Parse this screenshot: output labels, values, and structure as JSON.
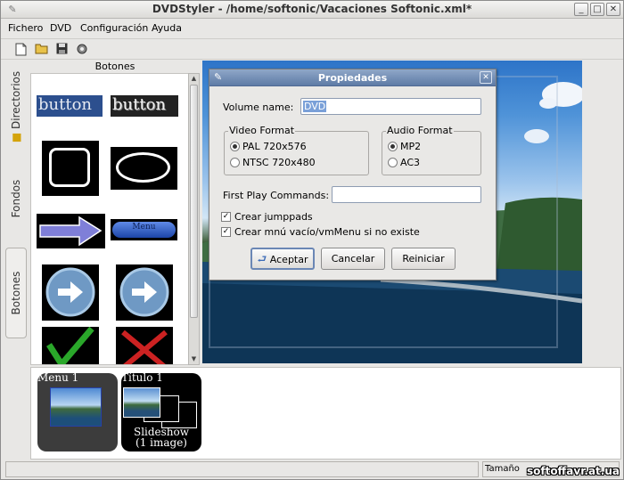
{
  "window": {
    "title": "DVDStyler - /home/softonic/Vacaciones Softonic.xml*",
    "controls": {
      "minimize": "_",
      "maximize": "□",
      "close": "✕"
    }
  },
  "menu": [
    {
      "label": "Fichero",
      "accel": "F"
    },
    {
      "label": "DVD",
      "accel": "D"
    },
    {
      "label": "Configuración",
      "accel": "C"
    },
    {
      "label": "Ayuda",
      "accel": "A"
    }
  ],
  "toolbar": {
    "icons": [
      "new-file-icon",
      "open-folder-icon",
      "save-icon",
      "settings-icon"
    ]
  },
  "side_tabs": {
    "directorios": "Directorios",
    "fondos": "Fondos",
    "botones": "Botones"
  },
  "buttons_panel": {
    "header": "Botones",
    "items": [
      {
        "type": "text-button",
        "text": "button"
      },
      {
        "type": "text-button-shadow",
        "text": "button"
      },
      {
        "type": "square-frame"
      },
      {
        "type": "ellipse-frame"
      },
      {
        "type": "arrow"
      },
      {
        "type": "pill",
        "text": "Menu"
      },
      {
        "type": "round-arrow"
      },
      {
        "type": "round-arrow"
      },
      {
        "type": "check"
      },
      {
        "type": "cross"
      }
    ]
  },
  "titleset": {
    "menu1": "Menu 1",
    "titulo1": "Título 1",
    "slideshow_line1": "Slideshow",
    "slideshow_line2": "(1 image)"
  },
  "status": {
    "left": "",
    "right": "Tamaño"
  },
  "watermark": "softoffavr.at.ua",
  "dialog": {
    "title": "Propiedades",
    "volume_label": "Volume name:",
    "volume_value": "DVD",
    "video_group": "Video Format",
    "video_options": [
      {
        "label": "PAL 720x576",
        "selected": true
      },
      {
        "label": "NTSC 720x480",
        "selected": false
      }
    ],
    "audio_group": "Audio Format",
    "audio_options": [
      {
        "label": "MP2",
        "selected": true
      },
      {
        "label": "AC3",
        "selected": false
      }
    ],
    "first_play_label": "First Play Commands:",
    "first_play_value": "",
    "check1": {
      "label": "Crear jumppads",
      "checked": true
    },
    "check2": {
      "label": "Crear mnú vacío/vmMenu si no existe",
      "checked": true
    },
    "ok": "Aceptar",
    "cancel": "Cancelar",
    "reset": "Reiniciar"
  },
  "colors": {
    "dialog_title_bg": "#6f8ab1",
    "selection": "#7aa0d8",
    "button_blue": "#2a5db8"
  }
}
